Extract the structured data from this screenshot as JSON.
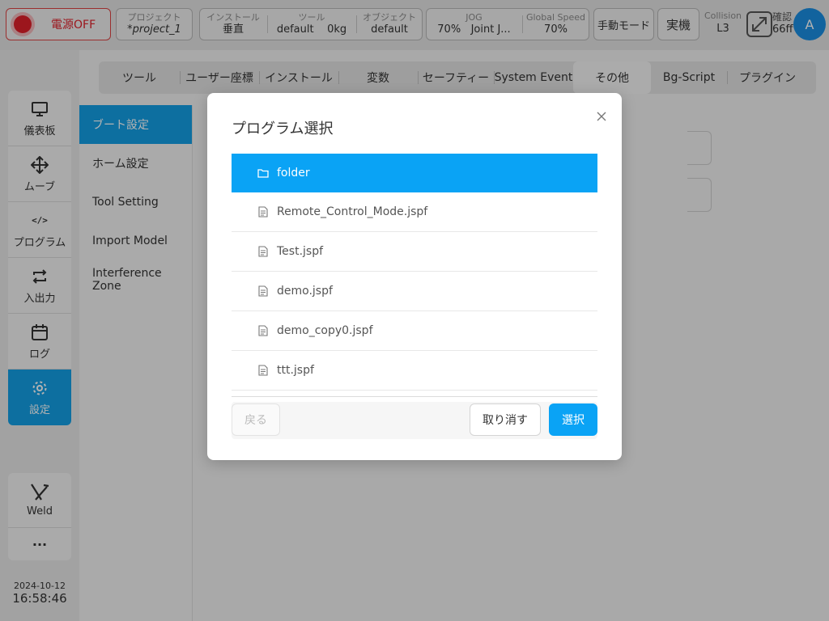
{
  "topbar": {
    "power_label": "電源OFF",
    "project": {
      "key": "プロジェクト",
      "value": "*project_1"
    },
    "install": {
      "key": "インストール",
      "value": "垂直"
    },
    "tool": {
      "key": "ツール",
      "value_name": "default",
      "value_weight": "0kg"
    },
    "object": {
      "key": "オブジェクト",
      "value": "default"
    },
    "jog": {
      "key": "JOG",
      "value_speed": "70%",
      "value_mode": "Joint J..."
    },
    "global_speed": {
      "key": "Global Speed",
      "value": "70%"
    },
    "manual_mode": "手動モード",
    "real_machine": "実機",
    "collision": {
      "key": "Collision",
      "value": "L3"
    },
    "confirm": {
      "key": "確認",
      "value": "66ff"
    },
    "avatar": "A"
  },
  "sidebar": {
    "items": [
      {
        "label": "儀表板",
        "icon": "monitor-icon"
      },
      {
        "label": "ムーブ",
        "icon": "move-arrows-icon"
      },
      {
        "label": "プログラム",
        "icon": "code-icon"
      },
      {
        "label": "入出力",
        "icon": "swap-icon"
      },
      {
        "label": "ログ",
        "icon": "calendar-icon"
      },
      {
        "label": "設定",
        "icon": "gear-icon",
        "active": true
      }
    ],
    "weld_label": "Weld",
    "more_label": "···",
    "date": "2024-10-12",
    "time": "16:58:46"
  },
  "tabs": [
    {
      "label": "ツール"
    },
    {
      "label": "ユーザー座標"
    },
    {
      "label": "インストール"
    },
    {
      "label": "変数"
    },
    {
      "label": "セーフティー"
    },
    {
      "label": "System Event"
    },
    {
      "label": "その他",
      "active": true
    },
    {
      "label": "Bg-Script"
    },
    {
      "label": "プラグイン"
    }
  ],
  "submenu": [
    {
      "label": "ブート設定",
      "active": true
    },
    {
      "label": "ホーム設定"
    },
    {
      "label": "Tool Setting"
    },
    {
      "label": "Import Model"
    },
    {
      "label": "Interference Zone"
    }
  ],
  "dialog": {
    "title": "プログラム選択",
    "files": [
      {
        "name": "folder",
        "type": "folder",
        "selected": true
      },
      {
        "name": "Remote_Control_Mode.jspf",
        "type": "file"
      },
      {
        "name": "Test.jspf",
        "type": "file"
      },
      {
        "name": "demo.jspf",
        "type": "file"
      },
      {
        "name": "demo_copy0.jspf",
        "type": "file"
      },
      {
        "name": "ttt.jspf",
        "type": "file"
      }
    ],
    "back_label": "戻る",
    "cancel_label": "取り消す",
    "select_label": "選択"
  },
  "colors": {
    "accent": "#0aa3f5",
    "power_red": "#e0202a"
  }
}
